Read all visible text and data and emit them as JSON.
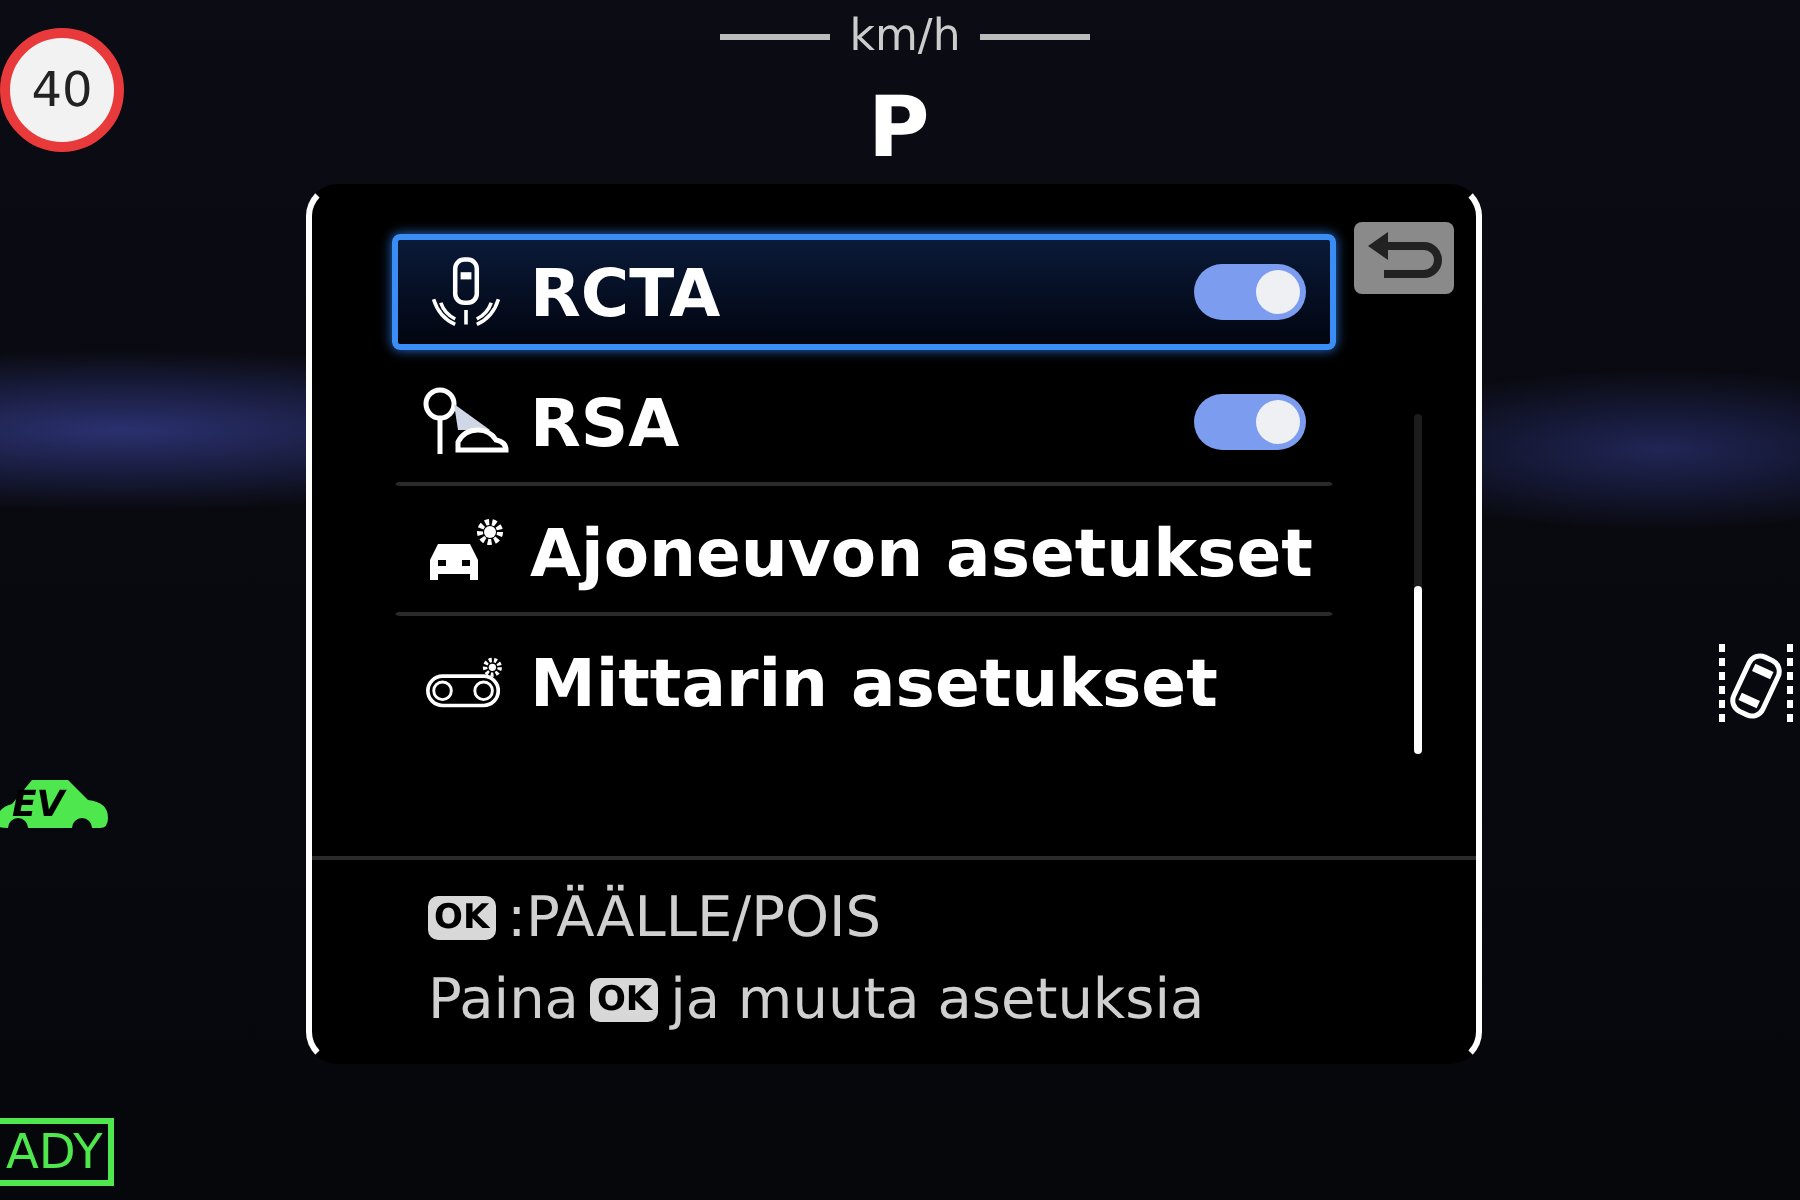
{
  "speed_limit": "40",
  "speed_unit": "km/h",
  "gear": "P",
  "menu": {
    "items": [
      {
        "kind": "toggle",
        "label": "RCTA",
        "selected": true,
        "on": true
      },
      {
        "kind": "toggle",
        "label": "RSA",
        "selected": false,
        "on": true
      },
      {
        "kind": "link",
        "label": "Ajoneuvon asetukset",
        "selected": false
      },
      {
        "kind": "link",
        "label": "Mittarin asetukset",
        "selected": false
      }
    ],
    "hint_1": {
      "key": "OK",
      "text": ":PÄÄLLE/POIS"
    },
    "hint_2": {
      "before": "Paina",
      "key": "OK",
      "after": "ja muuta asetuksia"
    }
  },
  "ev_indicator": "EV",
  "ready_indicator": "ADY"
}
